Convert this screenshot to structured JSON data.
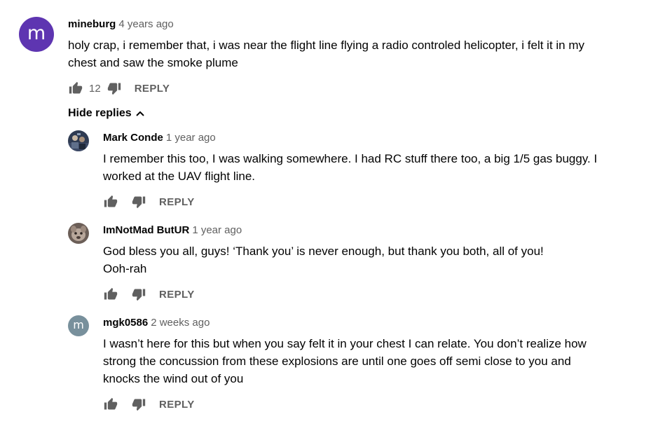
{
  "comment": {
    "avatar_letter": "m",
    "author": "mineburg",
    "time": "4 years ago",
    "text": "holy crap, i remember that, i was near the flight line flying a radio controled helicopter, i felt it in my chest and saw the smoke plume",
    "likes": "12",
    "reply_label": "REPLY"
  },
  "hide_replies_label": "Hide replies",
  "replies": [
    {
      "author": "Mark Conde",
      "time": "1 year ago",
      "text_lines": [
        "I remember this too, I was walking somewhere. I had RC stuff there too, a big 1/5 gas buggy. I",
        "worked at the UAV flight line."
      ],
      "reply_label": "REPLY"
    },
    {
      "author": "ImNotMad ButUR",
      "time": "1 year ago",
      "text_lines": [
        "God bless you all, guys! ‘Thank you’ is never enough, but thank you both, all of you!",
        "Ooh-rah"
      ],
      "reply_label": "REPLY"
    },
    {
      "avatar_letter": "m",
      "author": "mgk0586",
      "time": "2 weeks ago",
      "text_lines": [
        "I wasn’t here for this but when you say felt it in your chest I can relate.  You don’t realize how",
        "strong the concussion from these explosions are until one goes off semi close to you and",
        "knocks the wind out of you"
      ],
      "reply_label": "REPLY"
    }
  ],
  "colors": {
    "main_avatar_bg": "#5e35b1",
    "reply_avatar_bg": "#78909c",
    "secondary_text": "#606060",
    "primary_text": "#030303"
  },
  "icons": {
    "like": "thumbs-up-icon",
    "dislike": "thumbs-down-icon",
    "collapse": "chevron-up-icon"
  }
}
